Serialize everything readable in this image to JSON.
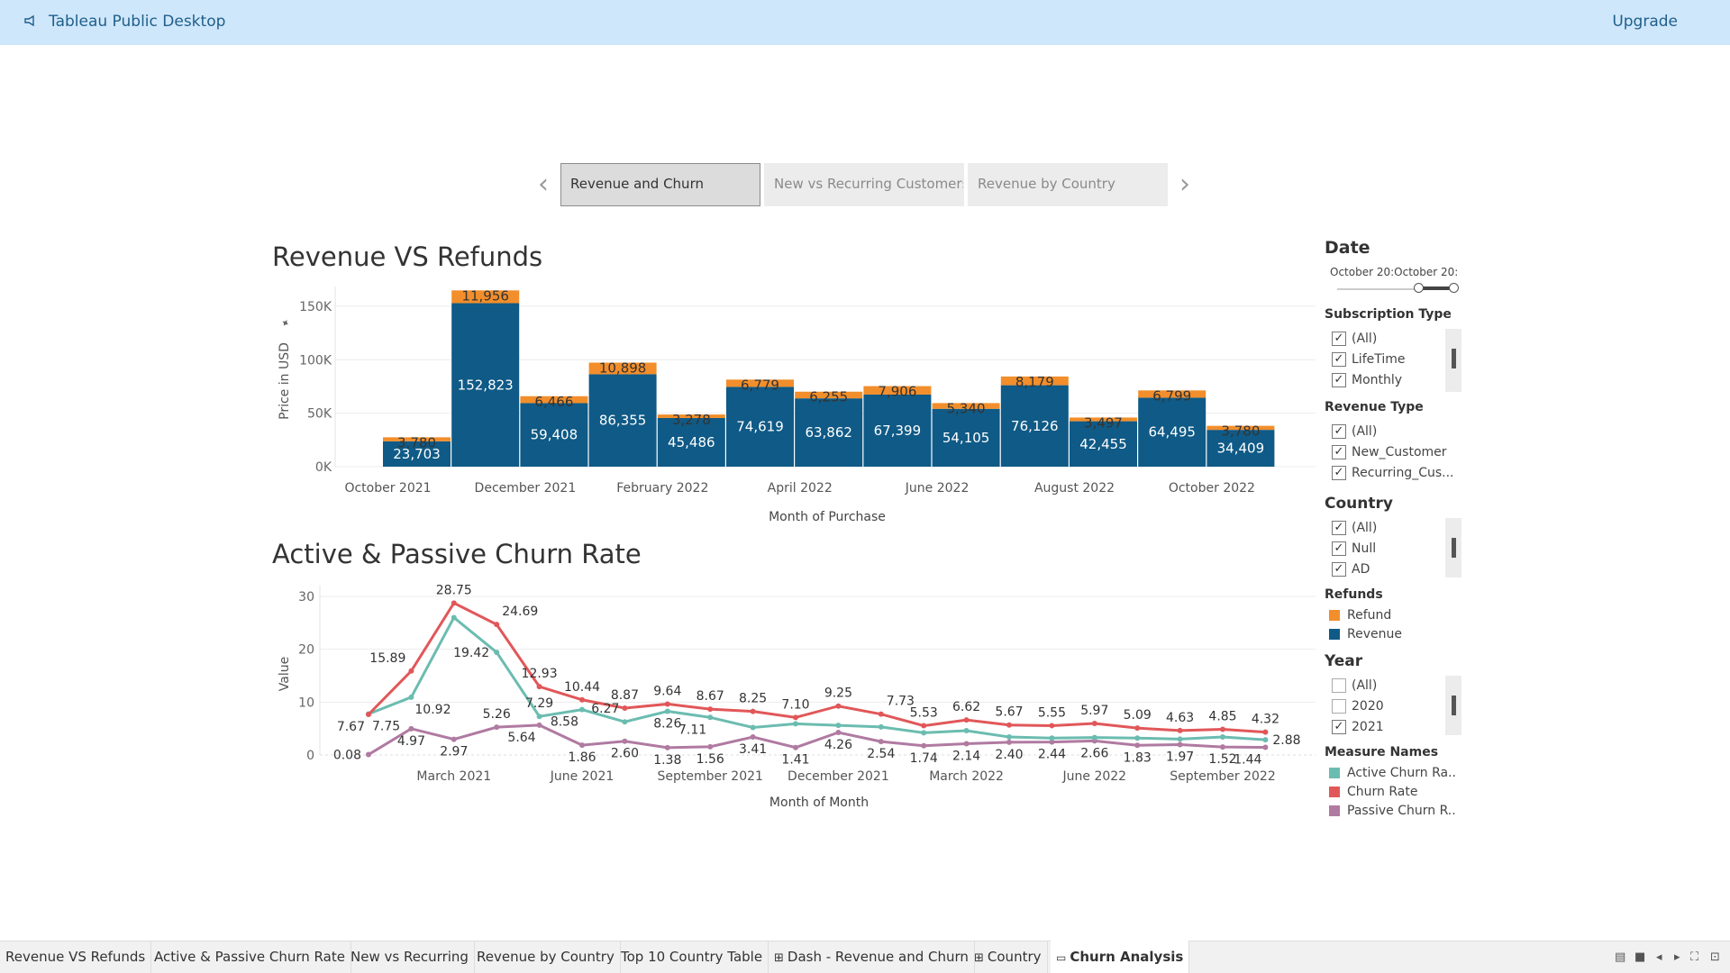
{
  "app": {
    "title": "Tableau Public Desktop",
    "upgrade": "Upgrade",
    "logo_icon": "megaphone-icon"
  },
  "story_nav": {
    "tabs": [
      {
        "label": "Revenue and Churn",
        "active": true
      },
      {
        "label": "New vs Recurring Customers",
        "active": false
      },
      {
        "label": "Revenue by Country",
        "active": false
      }
    ],
    "prev_icon": "chevron-left-icon",
    "next_icon": "chevron-right-icon"
  },
  "revenue_chart": {
    "title": "Revenue VS Refunds"
  },
  "churn_chart": {
    "title": "Active & Passive Churn Rate"
  },
  "chart_data": [
    {
      "type": "bar",
      "title": "Revenue VS Refunds",
      "xlabel": "Month of Purchase",
      "ylabel": "Price in USD",
      "ylim": [
        0,
        160000
      ],
      "yticks": [
        0,
        50000,
        100000,
        150000
      ],
      "ytick_labels": [
        "0K",
        "50K",
        "100K",
        "150K"
      ],
      "xtick_labels": [
        "October 2021",
        "December 2021",
        "February 2022",
        "April 2022",
        "June 2022",
        "August 2022",
        "October 2022"
      ],
      "categories": [
        "2021-10",
        "2021-12",
        "2022-01",
        "2022-02",
        "2022-03",
        "2022-04",
        "2022-05",
        "2022-06",
        "2022-07",
        "2022-08",
        "2022-09",
        "2022-10",
        "2022-11"
      ],
      "series": [
        {
          "name": "Revenue",
          "color": "#0f5a86",
          "values": [
            23703,
            152823,
            59408,
            86355,
            45486,
            74619,
            63862,
            67399,
            54105,
            76126,
            42455,
            64495,
            34409
          ]
        },
        {
          "name": "Refund",
          "color": "#f28e2b",
          "values": [
            3780,
            11956,
            6466,
            10898,
            3278,
            6779,
            6255,
            7906,
            5340,
            8179,
            3497,
            6799,
            3780
          ]
        }
      ],
      "value_labels": {
        "Revenue": [
          "23,703",
          "152,823",
          "59,408",
          "86,355",
          "45,486",
          "74,619",
          "63,862",
          "67,399",
          "54,105",
          "76,126",
          "42,455",
          "64,495",
          "34,409"
        ],
        "Refund": [
          "3,780",
          "11,956",
          "6,466",
          "10,898",
          "3,278",
          "6,779",
          "6,255",
          "7,906",
          "5,340",
          "8,179",
          "3,497",
          "6,799",
          "3,780"
        ]
      },
      "grid": true
    },
    {
      "type": "line",
      "title": "Active & Passive Churn Rate",
      "xlabel": "Month of Month",
      "ylabel": "Value",
      "ylim": [
        0,
        30
      ],
      "yticks": [
        0,
        10,
        20,
        30
      ],
      "xtick_labels": [
        "March 2021",
        "June 2021",
        "September 2021",
        "December 2021",
        "March 2022",
        "June 2022",
        "September 2022"
      ],
      "xtick_positions": [
        2,
        5,
        8,
        11,
        14,
        17,
        20
      ],
      "n_points": 22,
      "series": [
        {
          "name": "Churn Rate",
          "color": "#e15759",
          "values": [
            7.67,
            15.89,
            28.75,
            24.69,
            12.93,
            10.44,
            8.87,
            9.64,
            8.67,
            8.25,
            7.1,
            9.25,
            7.73,
            5.53,
            6.62,
            5.67,
            5.55,
            5.97,
            5.09,
            4.63,
            4.85,
            4.32
          ]
        },
        {
          "name": "Active Churn Rate",
          "color": "#6bbcb0",
          "values": [
            7.75,
            10.92,
            26.0,
            19.42,
            7.29,
            8.58,
            6.27,
            8.26,
            7.11,
            5.2,
            5.9,
            5.6,
            5.3,
            4.2,
            4.6,
            3.4,
            3.2,
            3.3,
            3.2,
            3.0,
            3.4,
            2.88
          ]
        },
        {
          "name": "Passive Churn Rate",
          "color": "#b07aa1",
          "values": [
            0.08,
            4.97,
            2.97,
            5.26,
            5.64,
            1.86,
            2.6,
            1.38,
            1.56,
            3.41,
            1.41,
            4.26,
            2.54,
            1.74,
            2.14,
            2.4,
            2.44,
            2.66,
            1.83,
            1.97,
            1.52,
            1.44
          ]
        }
      ],
      "point_labels": [
        {
          "i": 0,
          "text": "7.67",
          "s": "Churn Rate",
          "pos": "below-left"
        },
        {
          "i": 0,
          "text": "7.75",
          "s": "Active Churn Rate",
          "pos": "below-right"
        },
        {
          "i": 0,
          "text": "0.08",
          "s": "Passive Churn Rate",
          "pos": "left"
        },
        {
          "i": 1,
          "text": "15.89",
          "s": "Churn Rate",
          "pos": "above-left"
        },
        {
          "i": 1,
          "text": "10.92",
          "s": "Active Churn Rate",
          "pos": "below-right"
        },
        {
          "i": 1,
          "text": "4.97",
          "s": "Passive Churn Rate",
          "pos": "below"
        },
        {
          "i": 2,
          "text": "28.75",
          "s": "Churn Rate",
          "pos": "above"
        },
        {
          "i": 2,
          "text": "2.97",
          "s": "Passive Churn Rate",
          "pos": "below"
        },
        {
          "i": 3,
          "text": "24.69",
          "s": "Churn Rate",
          "pos": "above-right"
        },
        {
          "i": 3,
          "text": "19.42",
          "s": "Active Churn Rate",
          "pos": "left"
        },
        {
          "i": 3,
          "text": "5.26",
          "s": "Passive Churn Rate",
          "pos": "above"
        },
        {
          "i": 4,
          "text": "12.93",
          "s": "Churn Rate",
          "pos": "above"
        },
        {
          "i": 4,
          "text": "7.29",
          "s": "Active Churn Rate",
          "pos": "above"
        },
        {
          "i": 4,
          "text": "5.64",
          "s": "Passive Churn Rate",
          "pos": "below-left"
        },
        {
          "i": 5,
          "text": "10.44",
          "s": "Churn Rate",
          "pos": "above"
        },
        {
          "i": 5,
          "text": "8.58",
          "s": "Active Churn Rate",
          "pos": "below-left"
        },
        {
          "i": 5,
          "text": "1.86",
          "s": "Passive Churn Rate",
          "pos": "below"
        },
        {
          "i": 6,
          "text": "8.87",
          "s": "Churn Rate",
          "pos": "above"
        },
        {
          "i": 6,
          "text": "6.27",
          "s": "Active Churn Rate",
          "pos": "above-left"
        },
        {
          "i": 6,
          "text": "2.60",
          "s": "Passive Churn Rate",
          "pos": "below"
        },
        {
          "i": 7,
          "text": "9.64",
          "s": "Churn Rate",
          "pos": "above"
        },
        {
          "i": 7,
          "text": "8.26",
          "s": "Active Churn Rate",
          "pos": "below"
        },
        {
          "i": 7,
          "text": "1.38",
          "s": "Passive Churn Rate",
          "pos": "below"
        },
        {
          "i": 8,
          "text": "8.67",
          "s": "Churn Rate",
          "pos": "above"
        },
        {
          "i": 8,
          "text": "7.11",
          "s": "Active Churn Rate",
          "pos": "below-left"
        },
        {
          "i": 8,
          "text": "1.56",
          "s": "Passive Churn Rate",
          "pos": "below"
        },
        {
          "i": 9,
          "text": "8.25",
          "s": "Churn Rate",
          "pos": "above"
        },
        {
          "i": 9,
          "text": "3.41",
          "s": "Passive Churn Rate",
          "pos": "below"
        },
        {
          "i": 10,
          "text": "7.10",
          "s": "Churn Rate",
          "pos": "above"
        },
        {
          "i": 10,
          "text": "1.41",
          "s": "Passive Churn Rate",
          "pos": "below"
        },
        {
          "i": 11,
          "text": "9.25",
          "s": "Churn Rate",
          "pos": "above"
        },
        {
          "i": 11,
          "text": "4.26",
          "s": "Passive Churn Rate",
          "pos": "below"
        },
        {
          "i": 12,
          "text": "7.73",
          "s": "Churn Rate",
          "pos": "above-right"
        },
        {
          "i": 12,
          "text": "2.54",
          "s": "Passive Churn Rate",
          "pos": "below"
        },
        {
          "i": 13,
          "text": "5.53",
          "s": "Churn Rate",
          "pos": "above"
        },
        {
          "i": 13,
          "text": "1.74",
          "s": "Passive Churn Rate",
          "pos": "below"
        },
        {
          "i": 14,
          "text": "6.62",
          "s": "Churn Rate",
          "pos": "above"
        },
        {
          "i": 14,
          "text": "2.14",
          "s": "Passive Churn Rate",
          "pos": "below"
        },
        {
          "i": 15,
          "text": "5.67",
          "s": "Churn Rate",
          "pos": "above"
        },
        {
          "i": 15,
          "text": "2.40",
          "s": "Passive Churn Rate",
          "pos": "below"
        },
        {
          "i": 16,
          "text": "5.55",
          "s": "Churn Rate",
          "pos": "above"
        },
        {
          "i": 16,
          "text": "2.44",
          "s": "Passive Churn Rate",
          "pos": "below"
        },
        {
          "i": 17,
          "text": "5.97",
          "s": "Churn Rate",
          "pos": "above"
        },
        {
          "i": 17,
          "text": "2.66",
          "s": "Passive Churn Rate",
          "pos": "below"
        },
        {
          "i": 18,
          "text": "5.09",
          "s": "Churn Rate",
          "pos": "above"
        },
        {
          "i": 18,
          "text": "1.83",
          "s": "Passive Churn Rate",
          "pos": "below"
        },
        {
          "i": 19,
          "text": "4.63",
          "s": "Churn Rate",
          "pos": "above"
        },
        {
          "i": 19,
          "text": "1.97",
          "s": "Passive Churn Rate",
          "pos": "below"
        },
        {
          "i": 20,
          "text": "4.85",
          "s": "Churn Rate",
          "pos": "above"
        },
        {
          "i": 20,
          "text": "1.52",
          "s": "Passive Churn Rate",
          "pos": "below"
        },
        {
          "i": 21,
          "text": "4.32",
          "s": "Churn Rate",
          "pos": "above"
        },
        {
          "i": 21,
          "text": "2.88",
          "s": "Active Churn Rate",
          "pos": "right"
        },
        {
          "i": 21,
          "text": "1.44",
          "s": "Passive Churn Rate",
          "pos": "below-left"
        }
      ],
      "grid": true
    }
  ],
  "filters": {
    "date": {
      "title": "Date",
      "start": "October 20:",
      "end": "October 20:"
    },
    "subscription_type": {
      "title": "Subscription Type",
      "options": [
        {
          "label": "(All)",
          "checked": true
        },
        {
          "label": "LifeTime",
          "checked": true
        },
        {
          "label": "Monthly",
          "checked": true
        }
      ]
    },
    "revenue_type": {
      "title": "Revenue Type",
      "options": [
        {
          "label": "(All)",
          "checked": true
        },
        {
          "label": "New_Customer",
          "checked": true
        },
        {
          "label": "Recurring_Cus...",
          "checked": true
        }
      ]
    },
    "country": {
      "title": "Country",
      "options": [
        {
          "label": "(All)",
          "checked": true
        },
        {
          "label": "Null",
          "checked": true
        },
        {
          "label": "AD",
          "checked": true
        }
      ]
    },
    "year": {
      "title": "Year",
      "options": [
        {
          "label": "(All)",
          "checked": false
        },
        {
          "label": "2020",
          "checked": false
        },
        {
          "label": "2021",
          "checked": true
        }
      ]
    }
  },
  "legends": {
    "refunds": {
      "title": "Refunds",
      "items": [
        {
          "label": "Refund",
          "color": "#f28e2b"
        },
        {
          "label": "Revenue",
          "color": "#0f5a86"
        }
      ]
    },
    "measure_names": {
      "title": "Measure Names",
      "items": [
        {
          "label": "Active Churn Ra..",
          "color": "#6bbcb0"
        },
        {
          "label": "Churn Rate",
          "color": "#e15759"
        },
        {
          "label": "Passive Churn R..",
          "color": "#b07aa1"
        }
      ]
    }
  },
  "sheet_tabs": [
    {
      "label": "Revenue VS Refunds",
      "icon": "",
      "active": false
    },
    {
      "label": "Active & Passive Churn Rate",
      "icon": "",
      "active": false
    },
    {
      "label": "New vs Recurring",
      "icon": "",
      "active": false
    },
    {
      "label": "Revenue by Country",
      "icon": "",
      "active": false
    },
    {
      "label": "Top 10 Country Table",
      "icon": "",
      "active": false
    },
    {
      "label": "Dash - Revenue and Churn",
      "icon": "dashboard-icon",
      "active": false
    },
    {
      "label": "Country",
      "icon": "dashboard-icon",
      "active": false
    },
    {
      "label": "Churn Analysis",
      "icon": "story-icon",
      "active": true
    }
  ]
}
